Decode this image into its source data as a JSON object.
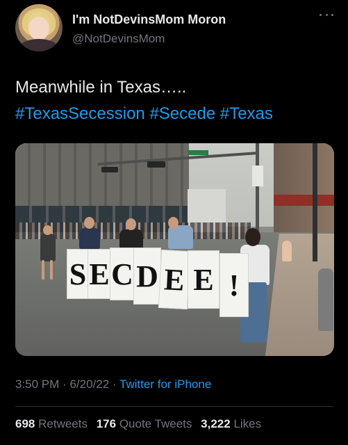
{
  "author": {
    "display_name": "I'm NotDevinsMom Moron",
    "handle": "@NotDevinsMom"
  },
  "tweet": {
    "text": "Meanwhile in Texas…..",
    "hashtags": "#TexasSecession #Secede #Texas"
  },
  "media": {
    "sign_letters": [
      "S",
      "E",
      "C",
      "D",
      "E",
      "E",
      "!"
    ]
  },
  "meta": {
    "time": "3:50 PM",
    "separator1": "·",
    "date": "6/20/22",
    "separator2": "·",
    "source": "Twitter for iPhone"
  },
  "stats": {
    "retweets_count": "698",
    "retweets_label": "Retweets",
    "quotes_count": "176",
    "quotes_label": "Quote Tweets",
    "likes_count": "3,222",
    "likes_label": "Likes"
  },
  "colors": {
    "background": "#000000",
    "text": "#e7e9ea",
    "secondary": "#71767b",
    "link": "#1d9bf0"
  }
}
